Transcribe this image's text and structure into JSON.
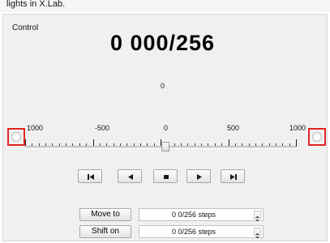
{
  "window": {
    "caption": "lights in X.Lab."
  },
  "group": {
    "title": "Control"
  },
  "display": {
    "position": "0 000/256",
    "slider_value": "0"
  },
  "scale": {
    "labels": [
      "1000",
      "-500",
      "0",
      "500",
      "1000"
    ]
  },
  "transport": {
    "buttons": [
      {
        "name": "skip-to-start",
        "icon": "skip-to-start-icon"
      },
      {
        "name": "step-back",
        "icon": "play-backward-icon"
      },
      {
        "name": "stop",
        "icon": "stop-icon"
      },
      {
        "name": "step-forward",
        "icon": "play-forward-icon"
      },
      {
        "name": "skip-to-end",
        "icon": "skip-to-end-icon"
      }
    ]
  },
  "actions": {
    "move_to_label": "Move to",
    "move_to_value": "0 0/256 steps",
    "shift_on_label": "Shift on",
    "shift_on_value": "0 0/256 steps"
  },
  "colors": {
    "highlight": "#e02525"
  }
}
